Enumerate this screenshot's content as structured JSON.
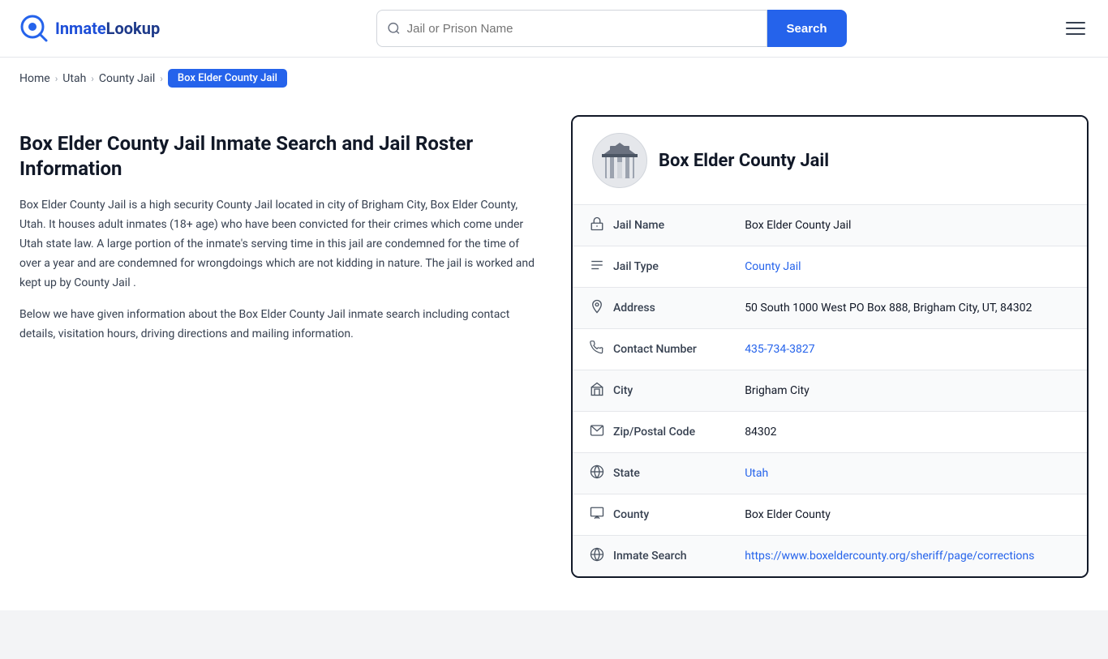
{
  "header": {
    "logo_brand": "InmateLookup",
    "logo_prefix": "Inmate",
    "logo_suffix": "Lookup",
    "search_placeholder": "Jail or Prison Name",
    "search_button_label": "Search"
  },
  "breadcrumb": {
    "items": [
      {
        "label": "Home",
        "href": "#"
      },
      {
        "label": "Utah",
        "href": "#"
      },
      {
        "label": "County Jail",
        "href": "#"
      }
    ],
    "current": "Box Elder County Jail"
  },
  "left": {
    "heading": "Box Elder County Jail Inmate Search and Jail Roster Information",
    "paragraph1": "Box Elder County Jail is a high security County Jail located in city of Brigham City, Box Elder County, Utah. It houses adult inmates (18+ age) who have been convicted for their crimes which come under Utah state law. A large portion of the inmate's serving time in this jail are condemned for the time of over a year and are condemned for wrongdoings which are not kidding in nature. The jail is worked and kept up by County Jail .",
    "paragraph2": "Below we have given information about the Box Elder County Jail inmate search including contact details, visitation hours, driving directions and mailing information."
  },
  "card": {
    "title": "Box Elder County Jail",
    "fields": [
      {
        "icon": "jail",
        "label": "Jail Name",
        "value": "Box Elder County Jail",
        "link": null
      },
      {
        "icon": "type",
        "label": "Jail Type",
        "value": "County Jail",
        "link": "#"
      },
      {
        "icon": "address",
        "label": "Address",
        "value": "50 South 1000 West PO Box 888, Brigham City, UT, 84302",
        "link": null
      },
      {
        "icon": "phone",
        "label": "Contact Number",
        "value": "435-734-3827",
        "link": "tel:435-734-3827"
      },
      {
        "icon": "city",
        "label": "City",
        "value": "Brigham City",
        "link": null
      },
      {
        "icon": "zip",
        "label": "Zip/Postal Code",
        "value": "84302",
        "link": null
      },
      {
        "icon": "state",
        "label": "State",
        "value": "Utah",
        "link": "#"
      },
      {
        "icon": "county",
        "label": "County",
        "value": "Box Elder County",
        "link": null
      },
      {
        "icon": "globe",
        "label": "Inmate Search",
        "value": "https://www.boxeldercounty.org/sheriff/page/corrections",
        "link": "https://www.boxeldercounty.org/sheriff/page/corrections"
      }
    ]
  }
}
